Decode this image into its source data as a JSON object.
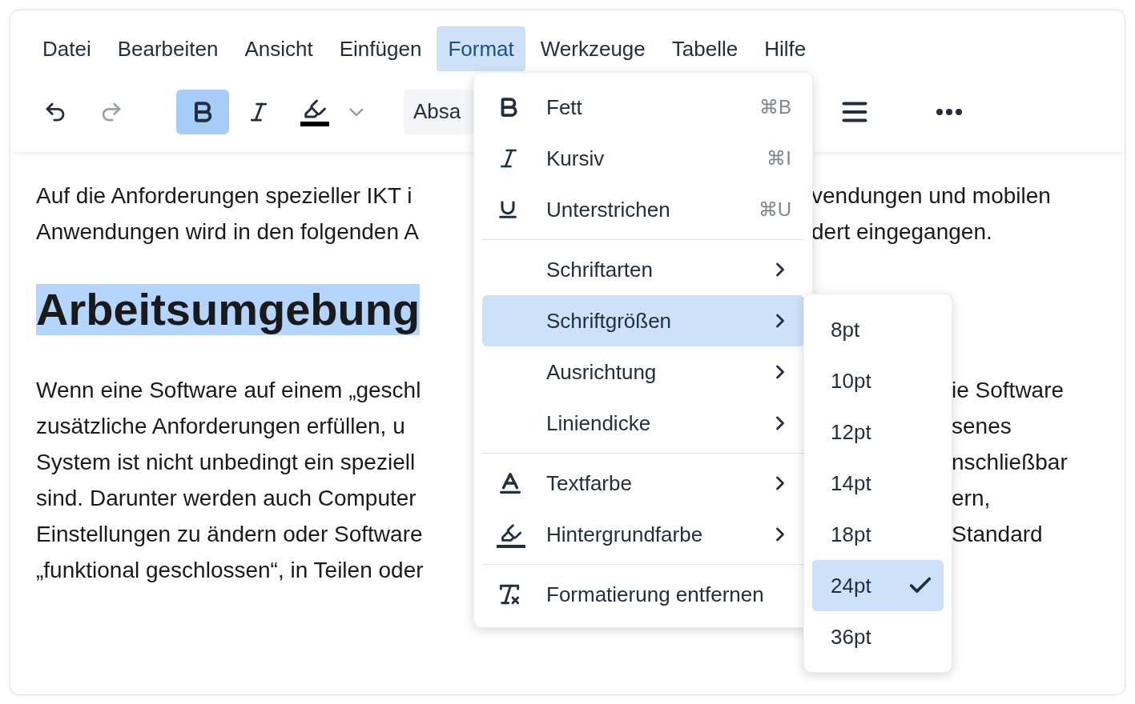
{
  "menubar": [
    {
      "label": "Datei",
      "selected": false
    },
    {
      "label": "Bearbeiten",
      "selected": false
    },
    {
      "label": "Ansicht",
      "selected": false
    },
    {
      "label": "Einfügen",
      "selected": false
    },
    {
      "label": "Format",
      "selected": true
    },
    {
      "label": "Werkzeuge",
      "selected": false
    },
    {
      "label": "Tabelle",
      "selected": false
    },
    {
      "label": "Hilfe",
      "selected": false
    }
  ],
  "toolbar": {
    "buttons_left": [
      {
        "kind": "undo",
        "disabled": false
      },
      {
        "kind": "redo",
        "disabled": true
      },
      {
        "kind": "bold",
        "active": true
      },
      {
        "kind": "italic",
        "active": false
      },
      {
        "kind": "highlight"
      },
      {
        "kind": "dropdown"
      }
    ],
    "block_format": {
      "value": "Absa"
    },
    "buttons_right": [
      {
        "kind": "justify"
      },
      {
        "kind": "more"
      }
    ]
  },
  "document": {
    "paragraphs": [
      {
        "kind": "text",
        "lines": [
          {
            "left": "Auf die Anforderungen spezieller IKT i",
            "right": "vendungen und mobilen"
          },
          {
            "left": "Anwendungen wird in den folgenden A",
            "right": "dert eingegangen."
          }
        ]
      },
      {
        "kind": "heading",
        "lines": [
          {
            "left": "Arbeitsumgebung"
          }
        ]
      },
      {
        "kind": "text",
        "lines": [
          {
            "left": "Wenn eine Software auf einem „geschl",
            "right": "ie Software"
          },
          {
            "left": "zusätzliche Anforderungen erfüllen, u",
            "right": "senes"
          },
          {
            "left": "System ist nicht unbedingt ein speziell",
            "right": "nschließbar"
          },
          {
            "left": "sind. Darunter werden auch Computer",
            "right": "ern,"
          },
          {
            "left": "Einstellungen zu ändern oder Software",
            "right": "Standard"
          },
          {
            "left": "„funktional geschlossen“, in Teilen oder"
          }
        ]
      }
    ]
  },
  "format_menu": {
    "items": [
      {
        "kind": "bold",
        "label": "Fett",
        "shortcut": "⌘B",
        "submenu": false,
        "selected": false
      },
      {
        "kind": "italic",
        "label": "Kursiv",
        "shortcut": "⌘I",
        "submenu": false,
        "selected": false
      },
      {
        "kind": "underline",
        "label": "Unterstrichen",
        "shortcut": "⌘U",
        "submenu": false,
        "selected": false
      },
      {
        "kind": "separator"
      },
      {
        "kind": "plain",
        "label": "Schriftarten",
        "submenu": true,
        "selected": false
      },
      {
        "kind": "plain",
        "label": "Schriftgrößen",
        "submenu": true,
        "selected": true
      },
      {
        "kind": "plain",
        "label": "Ausrichtung",
        "submenu": true,
        "selected": false
      },
      {
        "kind": "plain",
        "label": "Liniendicke",
        "submenu": true,
        "selected": false
      },
      {
        "kind": "separator"
      },
      {
        "kind": "text-color",
        "label": "Textfarbe",
        "submenu": true,
        "selected": false
      },
      {
        "kind": "highlight",
        "label": "Hintergrundfarbe",
        "submenu": true,
        "selected": false
      },
      {
        "kind": "separator"
      },
      {
        "kind": "clear-format",
        "label": "Formatierung entfernen",
        "submenu": false,
        "selected": false
      }
    ]
  },
  "font_sizes": [
    {
      "label": "8pt",
      "selected": false
    },
    {
      "label": "10pt",
      "selected": false
    },
    {
      "label": "12pt",
      "selected": false
    },
    {
      "label": "14pt",
      "selected": false
    },
    {
      "label": "18pt",
      "selected": false
    },
    {
      "label": "24pt",
      "selected": true
    },
    {
      "label": "36pt",
      "selected": false
    }
  ]
}
